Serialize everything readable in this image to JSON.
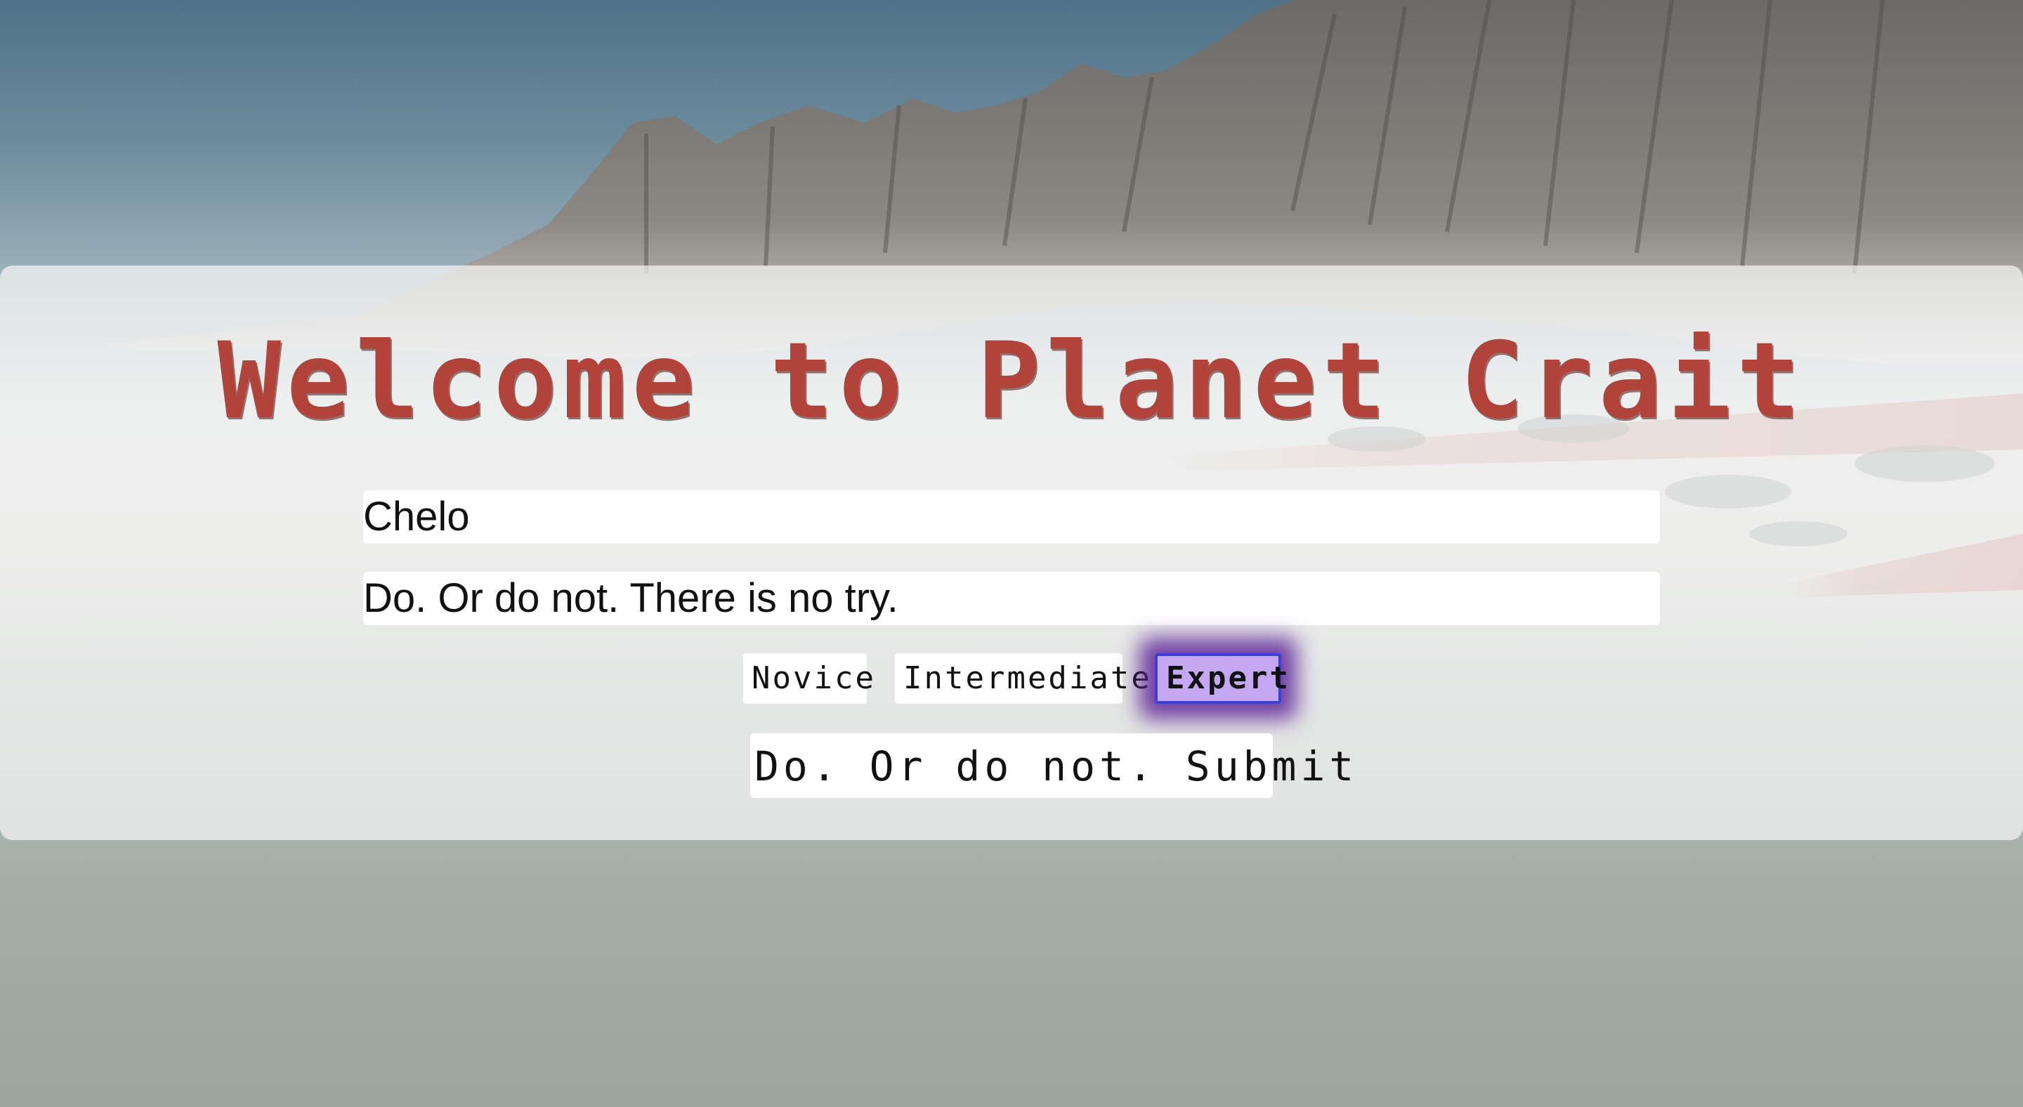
{
  "page": {
    "title": "Welcome to Planet Crait"
  },
  "form": {
    "name_value": "Chelo",
    "quote_value": "Do. Or do not. There is no try.",
    "levels": [
      {
        "label": "Novice",
        "selected": false
      },
      {
        "label": "Intermediate",
        "selected": false
      },
      {
        "label": "Expert",
        "selected": true
      }
    ],
    "submit_label": "Do. Or do not. Submit"
  },
  "colors": {
    "title": "#b2433a",
    "selected_level_bg": "#c5a8f2",
    "selected_level_border": "#3d3fd6",
    "selected_level_glow": "#5c2296"
  },
  "background": {
    "image": "crait-cliffs-salt-flats"
  }
}
